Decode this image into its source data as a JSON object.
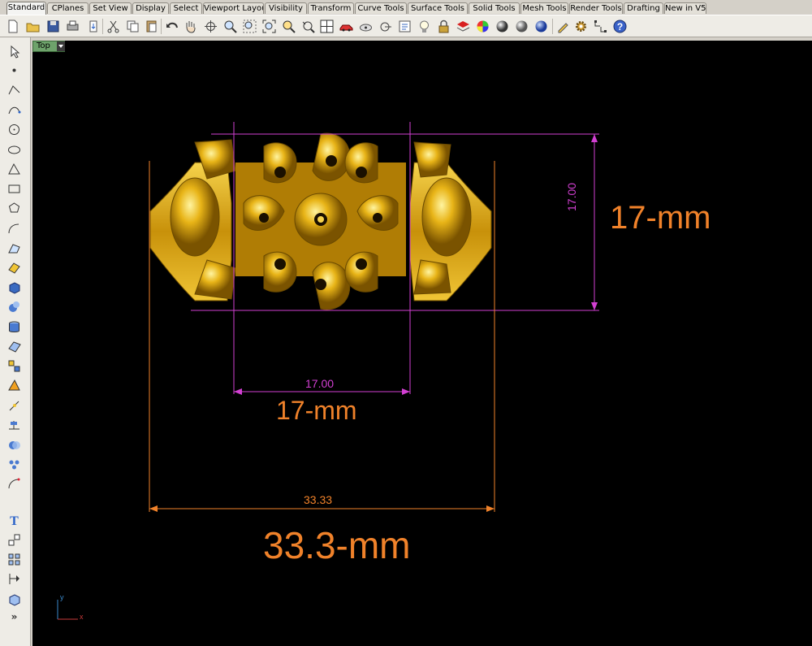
{
  "tabs": [
    {
      "label": "Standard",
      "active": true
    },
    {
      "label": "CPlanes"
    },
    {
      "label": "Set View"
    },
    {
      "label": "Display"
    },
    {
      "label": "Select"
    },
    {
      "label": "Viewport Layout"
    },
    {
      "label": "Visibility"
    },
    {
      "label": "Transform"
    },
    {
      "label": "Curve Tools"
    },
    {
      "label": "Surface Tools"
    },
    {
      "label": "Solid Tools"
    },
    {
      "label": "Mesh Tools"
    },
    {
      "label": "Render Tools"
    },
    {
      "label": "Drafting"
    },
    {
      "label": "New in V5"
    }
  ],
  "toolbar_icons": [
    "new-file-icon",
    "open-folder-icon",
    "save-icon",
    "print-icon",
    "import-icon",
    "cut-icon",
    "copy-icon",
    "paste-icon",
    "undo-icon",
    "pan-hand-icon",
    "rotate-view-icon",
    "zoom-dynamic-icon",
    "zoom-window-icon",
    "zoom-extents-icon",
    "zoom-selected-icon",
    "undo-view-icon",
    "four-viewports-icon",
    "car-render-icon",
    "snap-icon",
    "cplane-icon",
    "properties-icon",
    "light-icon",
    "lock-icon",
    "layer-icon",
    "color-wheel-icon",
    "sphere-shade-icon",
    "sphere-render-icon",
    "blue-sphere-icon",
    "pen-icon",
    "gear-icon",
    "grid-dots-icon",
    "help-icon"
  ],
  "left_icons": [
    "select-arrow-icon",
    "point-icon",
    "polyline-icon",
    "curve-icon",
    "circle-icon",
    "ellipse-icon",
    "triangle-icon",
    "rectangle-icon",
    "polygon-icon",
    "arc-tool-icon",
    "surface-edge-icon",
    "surface-icon",
    "box-solid-icon",
    "sphere-solid-icon",
    "cylinder-icon",
    "mesh-plane-icon",
    "puzzle-tools-icon",
    "blend-icon",
    "trim-icon",
    "split-icon",
    "boolean-icon",
    "explode-icon",
    "fillet-icon",
    "text-icon",
    "group-icon",
    "array-icon",
    "dimension-icon",
    "block-icon",
    "more-tools-icon"
  ],
  "viewport": {
    "name": "Top",
    "axis_y": "y",
    "axis_x": "x"
  },
  "dimensions": {
    "vertical_value": "17.00",
    "vertical_label": "17-mm",
    "inner_value": "17.00",
    "inner_label": "17-mm",
    "outer_value": "33.33",
    "outer_label": "33.3-mm"
  },
  "colors": {
    "viewport_bg": "#000000",
    "dim_magenta": "#d23fd2",
    "dim_orange": "#f0822a",
    "gold": "#e8b417"
  }
}
